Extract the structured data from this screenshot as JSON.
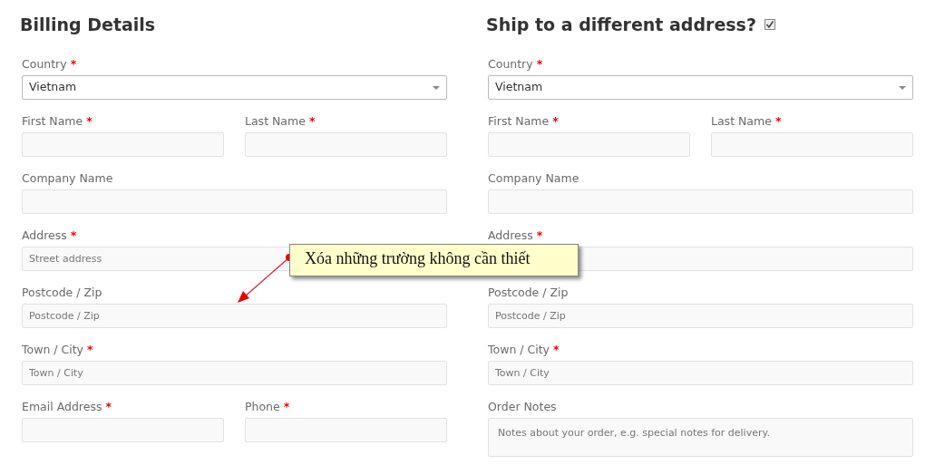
{
  "sections": [
    {
      "title": "Billing Details",
      "rows": [
        {
          "fields": [
            {
              "kind": "select",
              "label": "Country",
              "mark": "*",
              "value": "Vietnam"
            }
          ]
        },
        {
          "fields": [
            {
              "kind": "input",
              "label": "First Name",
              "mark": "*"
            },
            {
              "kind": "input",
              "label": "Last Name",
              "mark": "*"
            }
          ]
        },
        {
          "fields": [
            {
              "kind": "input",
              "label": "Company Name"
            }
          ]
        },
        {
          "fields": [
            {
              "kind": "input",
              "label": "Address",
              "mark": "*",
              "placeholder": "Street address"
            }
          ]
        },
        {
          "fields": [
            {
              "kind": "input",
              "label": "Postcode / Zip",
              "placeholder": "Postcode / Zip"
            }
          ]
        },
        {
          "fields": [
            {
              "kind": "input",
              "label": "Town / City",
              "mark": "*",
              "placeholder": "Town / City"
            }
          ]
        },
        {
          "fields": [
            {
              "kind": "input",
              "label": "Email Address",
              "mark": "*"
            },
            {
              "kind": "input",
              "label": "Phone",
              "mark": "*"
            }
          ]
        }
      ]
    },
    {
      "title": "Ship to a different address?",
      "checkbox": {
        "checked": true
      },
      "rows": [
        {
          "fields": [
            {
              "kind": "select",
              "label": "Country",
              "mark": "*",
              "value": "Vietnam"
            }
          ]
        },
        {
          "fields": [
            {
              "kind": "input",
              "label": "First Name",
              "mark": "*"
            },
            {
              "kind": "input",
              "label": "Last Name",
              "mark": "*"
            }
          ]
        },
        {
          "fields": [
            {
              "kind": "input",
              "label": "Company Name"
            }
          ]
        },
        {
          "fields": [
            {
              "kind": "input",
              "label": "Address",
              "mark": "*"
            }
          ]
        },
        {
          "fields": [
            {
              "kind": "input",
              "label": "Postcode / Zip",
              "placeholder": "Postcode / Zip"
            }
          ]
        },
        {
          "fields": [
            {
              "kind": "input",
              "label": "Town / City",
              "mark": "*",
              "placeholder": "Town / City"
            }
          ]
        },
        {
          "fields": [
            {
              "kind": "textarea",
              "label": "Order Notes",
              "placeholder": "Notes about your order, e.g. special notes for delivery."
            }
          ]
        }
      ]
    }
  ],
  "callout": {
    "text": "Xóa những trường không cần thiết"
  }
}
